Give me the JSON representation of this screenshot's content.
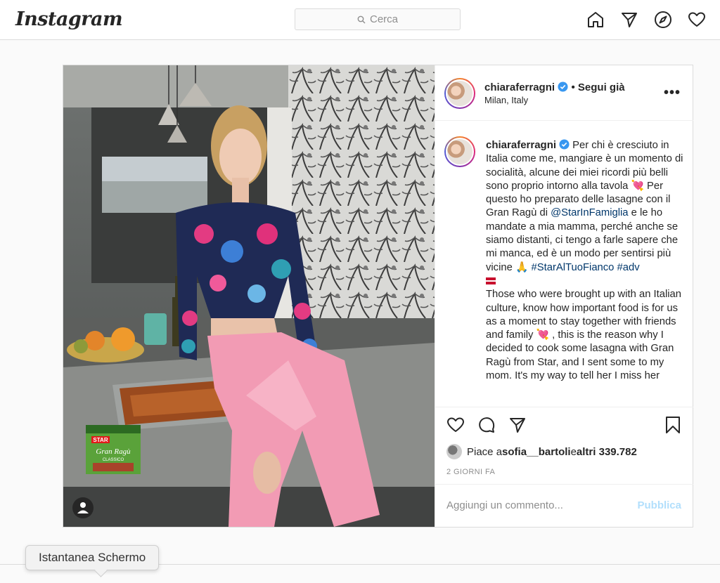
{
  "header": {
    "logo": "Instagram",
    "search_placeholder": "Cerca",
    "icons": [
      "home-icon",
      "direct-icon",
      "explore-icon",
      "activity-heart-icon"
    ]
  },
  "post": {
    "username": "chiaraferragni",
    "follow_status": "• Segui già",
    "location": "Milan, Italy",
    "more_label": "•••",
    "caption": {
      "text_1": "Per chi è cresciuto in Italia come me, mangiare è un momento di socialità, alcune dei miei ricordi più belli sono proprio intorno alla tavola ",
      "text_2": " Per questo ho preparato delle lasagne con il Gran Ragù di ",
      "mention": "@StarInFamiglia",
      "text_3": " e le ho mandate a mia mamma, perché anche se siamo distanti, ci tengo a farle sapere che mi manca, ed è un modo per sentirsi più vicine ",
      "pray_emoji": "🙏",
      "hashtag_1": "#StarAlTuoFianco",
      "hashtag_2": "#adv",
      "text_en_1": "Those who were brought up with an Italian culture, know how important food is for us as a moment to stay together with friends and family ",
      "text_en_2": " , this is the reason why I decided to cook some lasagna with Gran Ragù from Star, and I sent some to my mom. It's my way to tell her I miss her",
      "heart_emoji": "💘"
    },
    "likes": {
      "prefix": "Piace a ",
      "user": "sofia__bartoli",
      "middle": " e ",
      "others": "altri 339.782"
    },
    "date": "2 GIORNI FA",
    "comment_placeholder": "Aggiungi un commento...",
    "publish_label": "Pubblica"
  },
  "product_label": {
    "brand": "STAR",
    "name": "Gran Ragù",
    "variant": "CLASSICO"
  },
  "tooltip": {
    "label": "Istantanea Schermo"
  },
  "colors": {
    "link": "#00376b",
    "verified": "#3897f0",
    "publish_disabled": "#b2dffc",
    "pants_pink": "#f29bb4"
  }
}
